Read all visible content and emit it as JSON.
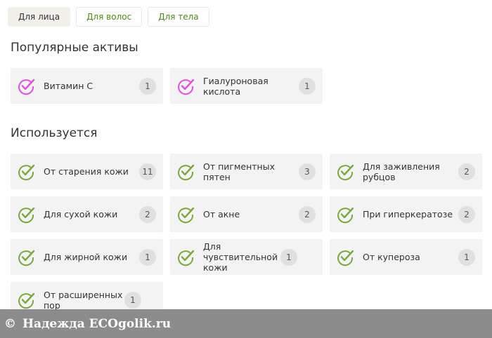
{
  "tabs": [
    {
      "label": "Для лица",
      "active": true
    },
    {
      "label": "Для волос",
      "active": false
    },
    {
      "label": "Для тела",
      "active": false
    }
  ],
  "popular": {
    "title": "Популярные активы",
    "check_color": "#e24fe0",
    "items": [
      {
        "label": "Витамин C",
        "count": "1"
      },
      {
        "label": "Гиалуроновая кислота",
        "count": "1"
      }
    ]
  },
  "used": {
    "title": "Используется",
    "check_color": "#7aa83c",
    "items": [
      {
        "label": "От старения кожи",
        "count": "11"
      },
      {
        "label": "От пигментных пятен",
        "count": "3"
      },
      {
        "label": "Для заживления рубцов",
        "count": "2"
      },
      {
        "label": "Для сухой кожи",
        "count": "2"
      },
      {
        "label": "От акне",
        "count": "2"
      },
      {
        "label": "При гиперкератозе",
        "count": "2"
      },
      {
        "label": "Для жирной кожи",
        "count": "1"
      },
      {
        "label": "Для чувствительной кожи",
        "count": "1"
      },
      {
        "label": "От купероза",
        "count": "1"
      },
      {
        "label": "От расширенных пор",
        "count": "1"
      }
    ]
  },
  "watermark": {
    "symbol": "©",
    "text": "Надежда ECOgolik.ru"
  }
}
